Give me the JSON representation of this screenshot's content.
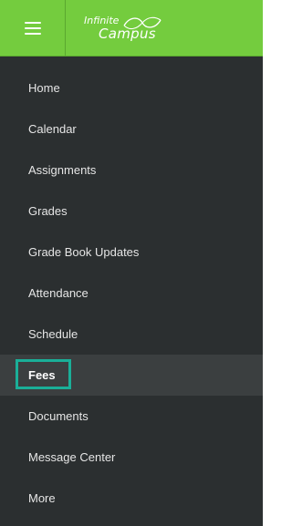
{
  "brand": {
    "logo_top": "Infinite",
    "logo_bottom": "Campus"
  },
  "nav": {
    "items": [
      {
        "label": "Home"
      },
      {
        "label": "Calendar"
      },
      {
        "label": "Assignments"
      },
      {
        "label": "Grades"
      },
      {
        "label": "Grade Book Updates"
      },
      {
        "label": "Attendance"
      },
      {
        "label": "Schedule"
      },
      {
        "label": "Fees"
      },
      {
        "label": "Documents"
      },
      {
        "label": "Message Center"
      },
      {
        "label": "More"
      }
    ],
    "selected": "Fees"
  },
  "colors": {
    "header_bg": "#74cc3e",
    "sidebar_bg": "#2b2f30",
    "highlight": "#1aaf98"
  }
}
